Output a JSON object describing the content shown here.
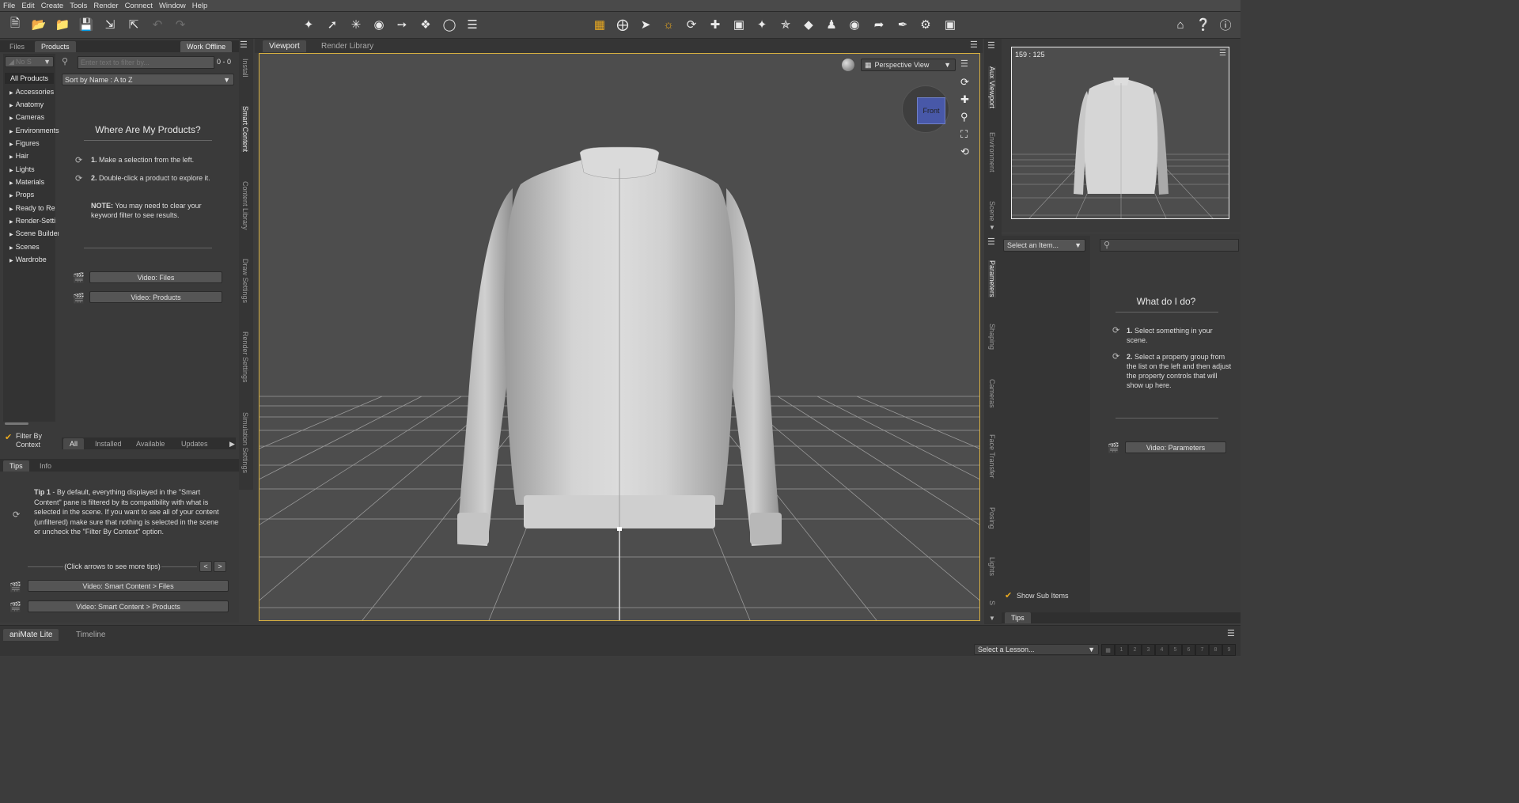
{
  "menu": [
    "File",
    "Edit",
    "Create",
    "Tools",
    "Render",
    "Connect",
    "Window",
    "Help"
  ],
  "left_panel": {
    "tabs": [
      "Files",
      "Products"
    ],
    "work_offline": "Work Offline",
    "no_selection": "No S",
    "filter_placeholder": "Enter text to filter by...",
    "count": "0 - 0",
    "sort": "Sort by Name : A to Z",
    "all_products": "All Products",
    "categories": [
      "Accessories",
      "Anatomy",
      "Cameras",
      "Environments",
      "Figures",
      "Hair",
      "Lights",
      "Materials",
      "Props",
      "Ready to Rend",
      "Render-Settin",
      "Scene Builder",
      "Scenes",
      "Wardrobe"
    ],
    "help_title": "Where Are My Products?",
    "step1_num": "1.",
    "step1": "Make a selection from the left.",
    "step2_num": "2.",
    "step2": "Double-click a product to explore it.",
    "note_label": "NOTE:",
    "note": "You may need to clear your keyword filter to see results.",
    "video_files": "Video: Files",
    "video_products": "Video: Products",
    "filter_by_context": "Filter By Context",
    "bottom_tabs": [
      "All",
      "Installed",
      "Available",
      "Updates"
    ]
  },
  "side_tabs_left": [
    "Install",
    "Smart Content",
    "Content Library",
    "Draw Settings",
    "Render Settings",
    "Simulation Settings"
  ],
  "tips_panel": {
    "tabs": [
      "Tips",
      "Info"
    ],
    "tip_label": "Tip 1",
    "tip_text": " - By default, everything displayed in the \"Smart Content\" pane is filtered by its compatibility with what is selected in the scene. If you want to see all of your content (unfiltered) make sure that nothing is selected in the scene or uncheck the \"Filter By Context\" option.",
    "nav_hint": "(Click arrows to see more tips)",
    "prev": "<",
    "next": ">",
    "video1": "Video: Smart Content > Files",
    "video2": "Video: Smart Content > Products"
  },
  "viewport": {
    "tabs": [
      "Viewport",
      "Render Library"
    ],
    "view_label": "Perspective View",
    "cube_label": "Front"
  },
  "aux": {
    "coords": "159 : 125",
    "side_tabs": [
      "Aux Viewport",
      "Environment",
      "Scene"
    ]
  },
  "params": {
    "select_item": "Select an Item...",
    "help_title": "What do I do?",
    "step1_num": "1.",
    "step1": "Select something in your scene.",
    "step2_num": "2.",
    "step2": "Select a property group from the list on the left and then adjust the property controls that will show up here.",
    "video": "Video: Parameters",
    "show_sub_items": "Show Sub Items",
    "tips": "Tips",
    "side_tabs": [
      "Parameters",
      "Shaping",
      "Cameras",
      "Face Transfer",
      "Posing",
      "Lights",
      "S"
    ]
  },
  "bottom": {
    "tabs": [
      "aniMate Lite",
      "Timeline"
    ],
    "lesson": "Select a Lesson...",
    "steps": [
      "1",
      "2",
      "3",
      "4",
      "5",
      "6",
      "7",
      "8",
      "9"
    ]
  },
  "colors": {
    "accent": "#e8a820",
    "viewport_bg": "#4d4d4d",
    "panel": "#3a3a3a"
  }
}
